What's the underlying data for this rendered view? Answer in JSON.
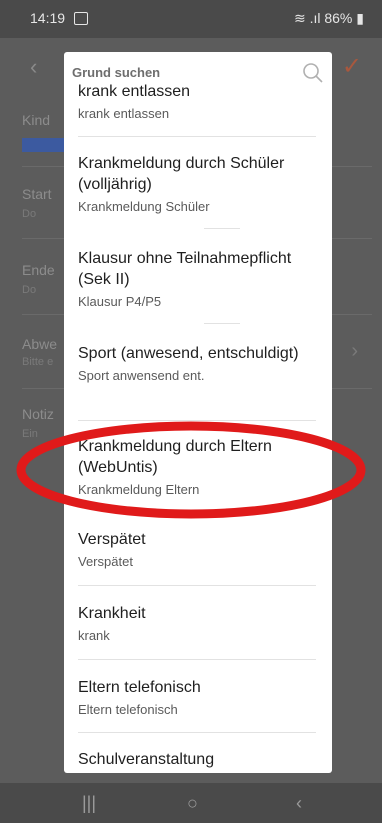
{
  "status_bar": {
    "time": "14:19",
    "battery": "86%"
  },
  "app": {
    "labels": [
      "Kind",
      "Start",
      "Ende",
      "Abwe",
      "Notiz"
    ],
    "subs": [
      "Do",
      "Do",
      "Bitte e",
      "Ein"
    ]
  },
  "dialog": {
    "search_title": "Grund suchen",
    "items": [
      {
        "title": "krank entlassen",
        "sub": "krank entlassen"
      },
      {
        "title": "Krankmeldung durch Schüler (volljährig)",
        "sub": "Krankmeldung Schüler"
      },
      {
        "title": "Klausur ohne Teilnahmepflicht (Sek II)",
        "sub": "Klausur P4/P5"
      },
      {
        "title": "Sport (anwesend, entschuldigt)",
        "sub": "Sport anwensend ent."
      },
      {
        "title": "Krankmeldung durch Eltern (WebUntis)",
        "sub": "Krankmeldung Eltern"
      },
      {
        "title": "Verspätet",
        "sub": "Verspätet"
      },
      {
        "title": "Krankheit",
        "sub": "krank"
      },
      {
        "title": "Eltern telefonisch",
        "sub": "Eltern telefonisch"
      },
      {
        "title": "Schulveranstaltung",
        "sub": ""
      }
    ]
  },
  "colors": {
    "annotation_oval": "#e01a1a",
    "accent_check": "#a8583e"
  }
}
